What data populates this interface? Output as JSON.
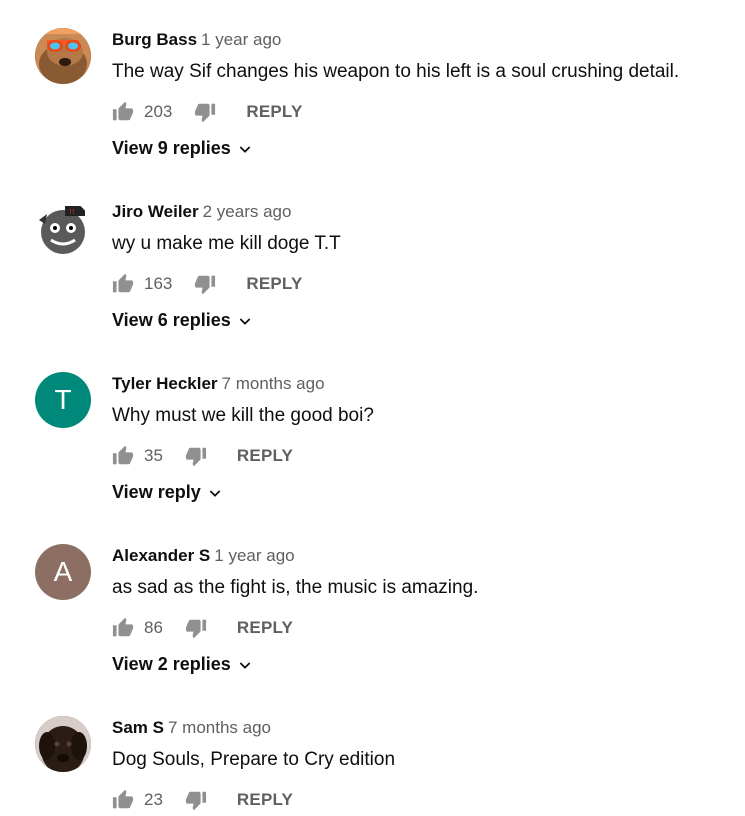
{
  "comments": [
    {
      "author": "Burg Bass",
      "time": "1 year ago",
      "text": "The way Sif changes his weapon to his left is a soul crushing detail.",
      "likes": "203",
      "reply_label": "REPLY",
      "view_replies": "View 9 replies",
      "avatar": {
        "type": "image",
        "icon": "dog-sunglasses-avatar"
      }
    },
    {
      "author": "Jiro Weiler",
      "time": "2 years ago",
      "text": "wy u make me kill doge T.T",
      "likes": "163",
      "reply_label": "REPLY",
      "view_replies": "View 6 replies",
      "avatar": {
        "type": "image",
        "icon": "cartoon-avatar"
      }
    },
    {
      "author": "Tyler Heckler",
      "time": "7 months ago",
      "text": "Why must we kill the good boi?",
      "likes": "35",
      "reply_label": "REPLY",
      "view_replies": "View reply",
      "avatar": {
        "type": "letter",
        "letter": "T",
        "color": "#00897b"
      }
    },
    {
      "author": "Alexander S",
      "time": "1 year ago",
      "text": "as sad as the fight is, the music is amazing.",
      "likes": "86",
      "reply_label": "REPLY",
      "view_replies": "View 2 replies",
      "avatar": {
        "type": "letter",
        "letter": "A",
        "color": "#8d6e63"
      }
    },
    {
      "author": "Sam S",
      "time": "7 months ago",
      "text": "Dog Souls, Prepare to Cry edition",
      "likes": "23",
      "reply_label": "REPLY",
      "avatar": {
        "type": "image",
        "icon": "dog-avatar"
      }
    }
  ],
  "colors": {
    "text_primary": "#0f0f0f",
    "text_secondary": "#606060",
    "icon": "#909090"
  }
}
